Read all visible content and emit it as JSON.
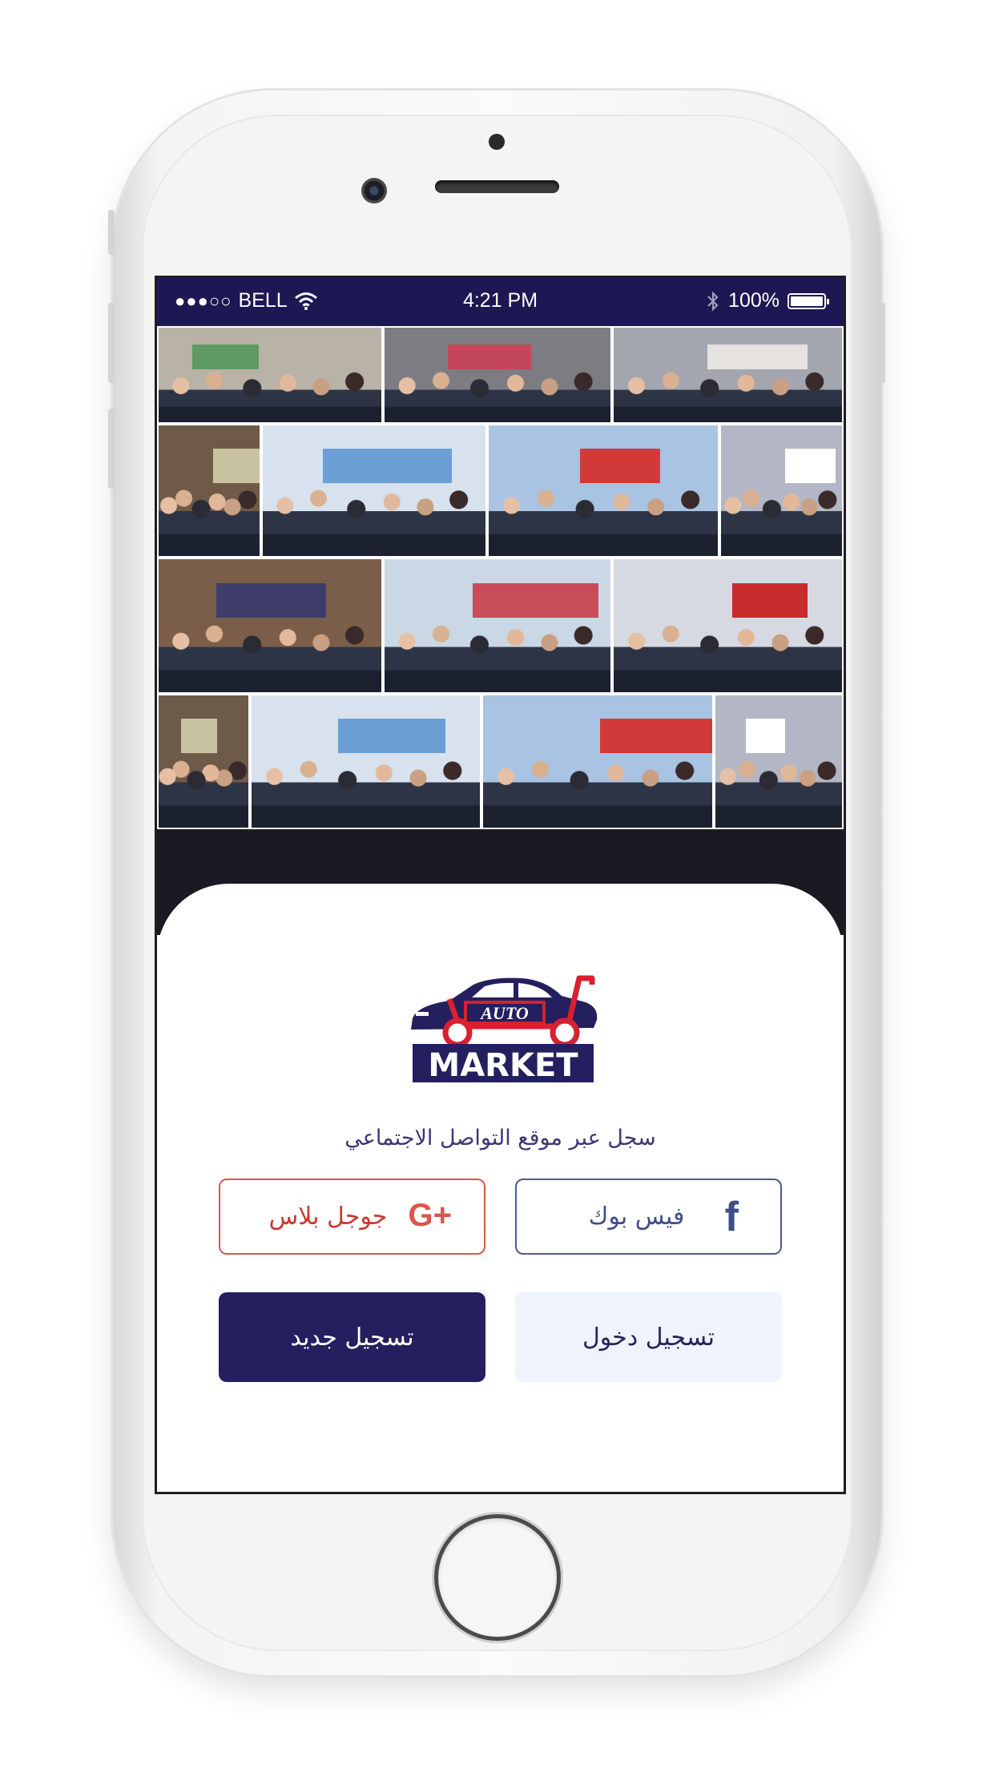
{
  "status_bar": {
    "signal": "●●●○○",
    "carrier": "BELL",
    "time": "4:21 PM",
    "battery": "100%",
    "battery_level_percent": 100
  },
  "collage": {
    "photos": [
      {
        "name": "expo-photo-1",
        "bg": "#b9b2a7",
        "banner": "#5f9a63"
      },
      {
        "name": "expo-photo-2",
        "bg": "#7d7c82",
        "banner": "#c4465a"
      },
      {
        "name": "expo-photo-3",
        "bg": "#a4a6af",
        "banner": "#e5e2e0"
      },
      {
        "name": "expo-photo-4",
        "bg": "#6f5a48",
        "banner": "#c9c2a0"
      },
      {
        "name": "expo-photo-5",
        "bg": "#d7e2ee",
        "banner": "#6aa0d5"
      },
      {
        "name": "expo-photo-6",
        "bg": "#a9c3e2",
        "banner": "#d23a3a"
      },
      {
        "name": "expo-photo-7",
        "bg": "#b3b6c4",
        "banner": "#ffffff"
      },
      {
        "name": "expo-photo-8",
        "bg": "#7a5e49",
        "banner": "#3e3d6a"
      },
      {
        "name": "expo-photo-9",
        "bg": "#c9d8e4",
        "banner": "#c84c5a"
      },
      {
        "name": "expo-photo-10",
        "bg": "#d6d9e2",
        "banner": "#c72b2b"
      },
      {
        "name": "expo-photo-11",
        "bg": "#6d5a48",
        "banner": "#c9c2a0"
      },
      {
        "name": "expo-photo-12",
        "bg": "#d7e2ee",
        "banner": "#6aa0d5"
      },
      {
        "name": "expo-photo-13",
        "bg": "#a9c3e2",
        "banner": "#d23a3a"
      },
      {
        "name": "expo-photo-14",
        "bg": "#b3b6c4",
        "banner": "#ffffff"
      }
    ]
  },
  "logo": {
    "word_top": "AUTO",
    "word_bottom": "MARKET",
    "navy": "#241f5e",
    "red": "#d8202f"
  },
  "login": {
    "social_caption": "سجل عبر موقع التواصل الاجتماعي",
    "google_label": "جوجل بلاس",
    "google_icon": "google-plus-icon",
    "google_icon_text": "G+",
    "facebook_label": "فيس بوك",
    "facebook_icon": "facebook-icon",
    "facebook_icon_text": "f",
    "register_label": "تسجيل جديد",
    "login_label": "تسجيل دخول"
  },
  "colors": {
    "status_bar": "#1d1853",
    "primary": "#241f5e",
    "google": "#d9564d",
    "facebook": "#3f4f86",
    "login_bg": "#eef3fc"
  }
}
